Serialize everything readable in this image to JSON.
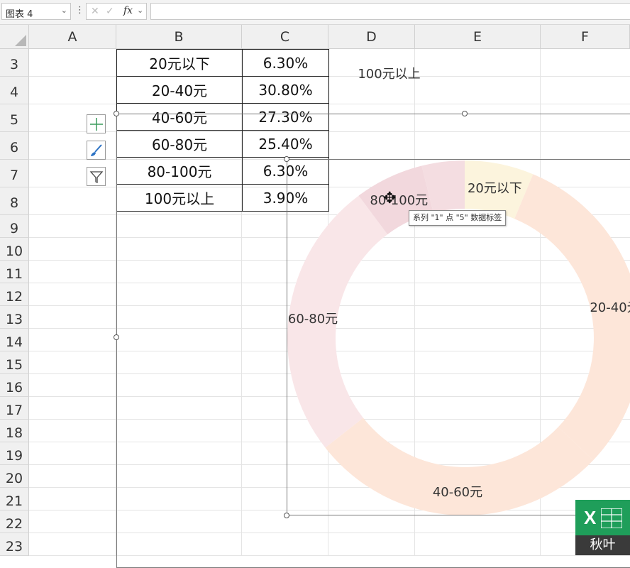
{
  "formula_bar": {
    "name_box": "图表 4",
    "fx_label": "fx",
    "formula": ""
  },
  "columns": [
    "A",
    "B",
    "C",
    "D",
    "E",
    "F"
  ],
  "rows": [
    "3",
    "4",
    "5",
    "6",
    "7",
    "8",
    "9",
    "10",
    "11",
    "12",
    "13",
    "14",
    "15",
    "16",
    "17",
    "18",
    "19",
    "20",
    "21",
    "22",
    "23"
  ],
  "table": [
    {
      "label": "20元以下",
      "value": "6.30%"
    },
    {
      "label": "20-40元",
      "value": "30.80%"
    },
    {
      "label": "40-60元",
      "value": "27.30%"
    },
    {
      "label": "60-80元",
      "value": "25.40%"
    },
    {
      "label": "80-100元",
      "value": "6.30%"
    },
    {
      "label": "100元以上",
      "value": "3.90%"
    }
  ],
  "tooltip": "系列 \"1\" 点 \"5\" 数据标签",
  "logo_text": "秋叶",
  "logo_letter": "X",
  "chart_data": {
    "type": "pie",
    "variant": "doughnut",
    "categories": [
      "20元以下",
      "20-40元",
      "40-60元",
      "60-80元",
      "80-100元",
      "100元以上"
    ],
    "values": [
      6.3,
      30.8,
      27.3,
      25.4,
      6.3,
      3.9
    ],
    "colors": [
      "#fcf4dd",
      "#fde6d9",
      "#fde6d9",
      "#f9e6e8",
      "#f2d8dd",
      "#f4dde1"
    ],
    "data_labels": [
      "20元以下",
      "20-40元",
      "40-60元",
      "60-80元",
      "80-100元",
      "100元以上"
    ]
  }
}
